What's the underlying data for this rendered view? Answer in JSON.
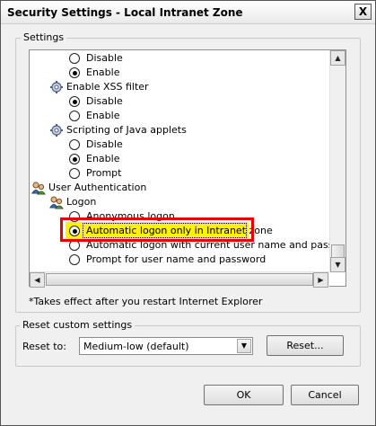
{
  "window": {
    "title": "Security Settings - Local Intranet Zone",
    "close_glyph": "X"
  },
  "settings_group": {
    "label": "Settings"
  },
  "tree": [
    {
      "type": "radio",
      "label": "Disable",
      "checked": false
    },
    {
      "type": "radio",
      "label": "Enable",
      "checked": true
    },
    {
      "type": "category",
      "icon": "gear-icon",
      "label": "Enable XSS filter"
    },
    {
      "type": "radio",
      "label": "Disable",
      "checked": true
    },
    {
      "type": "radio",
      "label": "Enable",
      "checked": false
    },
    {
      "type": "category",
      "icon": "gear-icon",
      "label": "Scripting of Java applets"
    },
    {
      "type": "radio",
      "label": "Disable",
      "checked": false
    },
    {
      "type": "radio",
      "label": "Enable",
      "checked": true
    },
    {
      "type": "radio",
      "label": "Prompt",
      "checked": false
    },
    {
      "type": "category",
      "icon": "people-icon",
      "label": "User Authentication"
    },
    {
      "type": "subcategory",
      "icon": "people-icon",
      "label": "Logon"
    },
    {
      "type": "radio",
      "label": "Anonymous logon",
      "checked": false
    },
    {
      "type": "radio",
      "label": "Automatic logon only in Intranet zone",
      "checked": true,
      "highlighted": true
    },
    {
      "type": "radio",
      "label": "Automatic logon with current user name and password",
      "checked": false
    },
    {
      "type": "radio",
      "label": "Prompt for user name and password",
      "checked": false
    }
  ],
  "note": "*Takes effect after you restart Internet Explorer",
  "reset_group": {
    "label": "Reset custom settings",
    "reset_to_label": "Reset to:",
    "selected_level": "Medium-low (default)",
    "reset_button": "Reset..."
  },
  "buttons": {
    "ok": "OK",
    "cancel": "Cancel"
  },
  "colors": {
    "highlight_border": "#e70000",
    "highlight_fill": "#fef200"
  }
}
